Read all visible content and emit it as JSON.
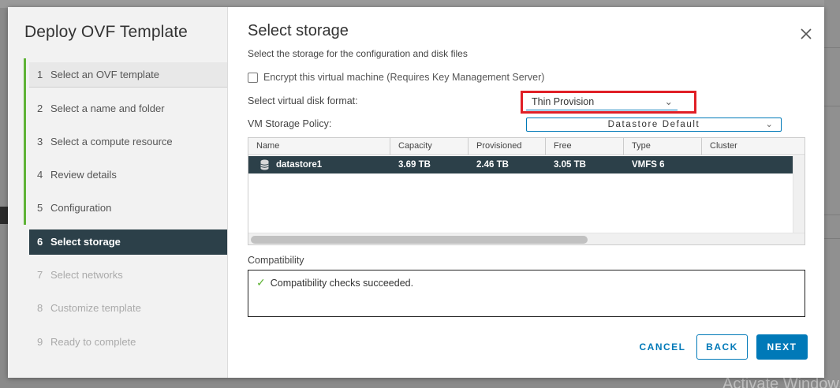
{
  "background": {
    "watermark": "Activate Windows"
  },
  "wizard": {
    "title": "Deploy OVF Template",
    "steps": [
      {
        "num": "1",
        "label": "Select an OVF template"
      },
      {
        "num": "2",
        "label": "Select a name and folder"
      },
      {
        "num": "3",
        "label": "Select a compute resource"
      },
      {
        "num": "4",
        "label": "Review details"
      },
      {
        "num": "5",
        "label": "Configuration"
      },
      {
        "num": "6",
        "label": "Select storage"
      },
      {
        "num": "7",
        "label": "Select networks"
      },
      {
        "num": "8",
        "label": "Customize template"
      },
      {
        "num": "9",
        "label": "Ready to complete"
      }
    ],
    "active_step": 6
  },
  "page": {
    "title": "Select storage",
    "subtitle": "Select the storage for the configuration and disk files",
    "close_icon": "close-icon"
  },
  "encrypt": {
    "label": "Encrypt this virtual machine (Requires Key Management Server)",
    "checked": false
  },
  "disk_format": {
    "label": "Select virtual disk format:",
    "value": "Thin Provision",
    "chevron": "⌄"
  },
  "storage_policy": {
    "label": "VM Storage Policy:",
    "value": "Datastore Default",
    "chevron": "⌄"
  },
  "grid": {
    "columns": [
      "Name",
      "Capacity",
      "Provisioned",
      "Free",
      "Type",
      "Cluster"
    ],
    "rows": [
      {
        "name": "datastore1",
        "capacity": "3.69 TB",
        "provisioned": "2.46 TB",
        "free": "3.05 TB",
        "type": "VMFS 6",
        "cluster": ""
      }
    ]
  },
  "compatibility": {
    "label": "Compatibility",
    "message": "Compatibility checks succeeded.",
    "icon": "✓"
  },
  "buttons": {
    "cancel": "CANCEL",
    "back": "BACK",
    "next": "NEXT"
  },
  "colors": {
    "accent": "#0079b8",
    "active_step_bg": "#2c4049",
    "progress_green": "#5fb336",
    "highlight_red": "#e01f26"
  }
}
